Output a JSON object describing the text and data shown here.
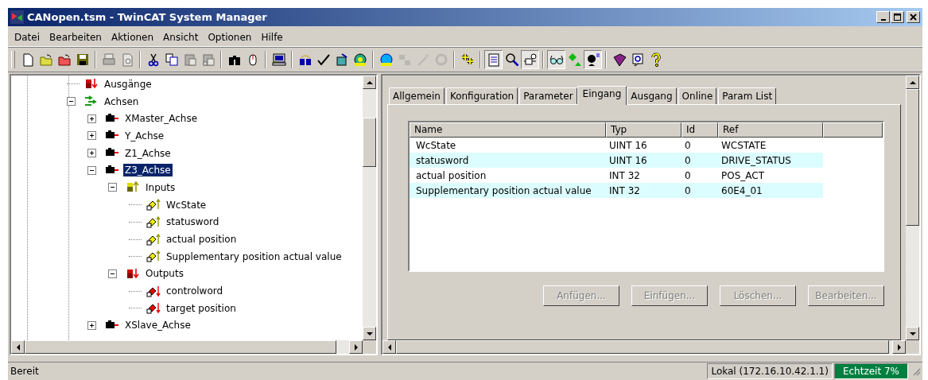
{
  "window": {
    "title": "CANopen.tsm - TwinCAT System Manager"
  },
  "menu": [
    "Datei",
    "Bearbeiten",
    "Aktionen",
    "Ansicht",
    "Optionen",
    "Hilfe"
  ],
  "toolbar": [
    [
      {
        "disabled": false,
        "pressed": false
      },
      {
        "disabled": false,
        "pressed": false
      },
      {
        "disabled": false,
        "pressed": false
      },
      {
        "disabled": false,
        "pressed": false
      }
    ],
    [
      {
        "disabled": true,
        "pressed": false
      },
      {
        "disabled": true,
        "pressed": false
      }
    ],
    [
      {
        "disabled": false,
        "pressed": false
      },
      {
        "disabled": false,
        "pressed": false
      },
      {
        "disabled": true,
        "pressed": false
      },
      {
        "disabled": true,
        "pressed": false
      }
    ],
    [
      {
        "disabled": false,
        "pressed": false
      },
      {
        "disabled": false,
        "pressed": false
      }
    ],
    [
      {
        "disabled": false,
        "pressed": false
      }
    ],
    [
      {
        "disabled": false,
        "pressed": false
      },
      {
        "disabled": false,
        "pressed": false
      },
      {
        "disabled": false,
        "pressed": false
      },
      {
        "disabled": false,
        "pressed": false
      }
    ],
    [
      {
        "disabled": false,
        "pressed": false
      },
      {
        "disabled": true,
        "pressed": false
      },
      {
        "disabled": true,
        "pressed": false
      },
      {
        "disabled": true,
        "pressed": false
      }
    ],
    [
      {
        "disabled": false,
        "pressed": false
      }
    ],
    [
      {
        "disabled": false,
        "pressed": true
      },
      {
        "disabled": false,
        "pressed": false
      },
      {
        "disabled": false,
        "pressed": true
      }
    ],
    [
      {
        "disabled": false,
        "pressed": true
      },
      {
        "disabled": false,
        "pressed": false
      },
      {
        "disabled": false,
        "pressed": true
      }
    ],
    [
      {
        "disabled": false,
        "pressed": false
      },
      {
        "disabled": false,
        "pressed": false
      },
      {
        "disabled": false,
        "pressed": false
      }
    ]
  ],
  "tree": [
    {
      "label": "Ausgänge",
      "kind": "output-group",
      "selected": false
    },
    {
      "label": "Achsen",
      "kind": "axes",
      "selected": false,
      "expanded": true,
      "children": [
        {
          "label": "XMaster_Achse",
          "kind": "axis",
          "selected": false,
          "expanded": false
        },
        {
          "label": "Y_Achse",
          "kind": "axis",
          "selected": false,
          "expanded": false
        },
        {
          "label": "Z1_Achse",
          "kind": "axis",
          "selected": false,
          "expanded": false
        },
        {
          "label": "Z3_Achse",
          "kind": "axis",
          "selected": true,
          "expanded": true,
          "children": [
            {
              "label": "Inputs",
              "kind": "input-group",
              "selected": false,
              "expanded": true,
              "children": [
                {
                  "label": "WcState",
                  "kind": "input-var",
                  "selected": false
                },
                {
                  "label": "statusword",
                  "kind": "input-var",
                  "selected": false
                },
                {
                  "label": "actual position",
                  "kind": "input-var",
                  "selected": false
                },
                {
                  "label": "Supplementary position actual value",
                  "kind": "input-var",
                  "selected": false
                }
              ]
            },
            {
              "label": "Outputs",
              "kind": "output-group",
              "selected": false,
              "expanded": true,
              "children": [
                {
                  "label": "controlword",
                  "kind": "output-var",
                  "selected": false
                },
                {
                  "label": "target position",
                  "kind": "output-var",
                  "selected": false
                }
              ]
            }
          ]
        },
        {
          "label": "XSlave_Achse",
          "kind": "axis",
          "selected": false,
          "expanded": false
        }
      ]
    }
  ],
  "tabs": [
    {
      "label": "Allgemein",
      "selected": false
    },
    {
      "label": "Konfiguration",
      "selected": false
    },
    {
      "label": "Parameter",
      "selected": false
    },
    {
      "label": "Eingang",
      "selected": true
    },
    {
      "label": "Ausgang",
      "selected": false
    },
    {
      "label": "Online",
      "selected": false
    },
    {
      "label": "Param List",
      "selected": false
    }
  ],
  "table": {
    "columns": [
      "Name",
      "Typ",
      "Id",
      "Ref"
    ],
    "rows": [
      {
        "cells": [
          "WcState",
          "UINT 16",
          "0",
          "WCSTATE"
        ],
        "highlighted": false
      },
      {
        "cells": [
          "statusword",
          "UINT 16",
          "0",
          "DRIVE_STATUS"
        ],
        "highlighted": true
      },
      {
        "cells": [
          "actual position",
          "INT 32",
          "0",
          "POS_ACT"
        ],
        "highlighted": false
      },
      {
        "cells": [
          "Supplementary position actual value",
          "INT 32",
          "0",
          "60E4_01"
        ],
        "highlighted": true
      }
    ]
  },
  "buttons": [
    {
      "label": "Anfügen...",
      "disabled": true
    },
    {
      "label": "Einfügen...",
      "disabled": true
    },
    {
      "label": "Löschen...",
      "disabled": true
    },
    {
      "label": "Bearbeiten...",
      "disabled": true
    }
  ],
  "status_bar": {
    "message": "Bereit",
    "connection": "Lokal (172.16.10.42.1.1)",
    "realtime": "Echtzeit 7%"
  }
}
